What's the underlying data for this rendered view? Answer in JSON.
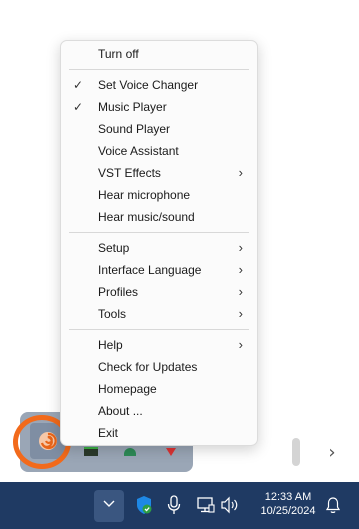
{
  "context_menu": {
    "items": [
      {
        "label": "Turn off",
        "checked": false,
        "submenu": false
      },
      {
        "label": "Set Voice Changer",
        "checked": true,
        "submenu": false
      },
      {
        "label": "Music Player",
        "checked": true,
        "submenu": false
      },
      {
        "label": "Sound Player",
        "checked": false,
        "submenu": false
      },
      {
        "label": "Voice Assistant",
        "checked": false,
        "submenu": false
      },
      {
        "label": "VST Effects",
        "checked": false,
        "submenu": true
      },
      {
        "label": "Hear microphone",
        "checked": false,
        "submenu": false
      },
      {
        "label": "Hear music/sound",
        "checked": false,
        "submenu": false
      },
      {
        "label": "Setup",
        "checked": false,
        "submenu": true
      },
      {
        "label": "Interface Language",
        "checked": false,
        "submenu": true
      },
      {
        "label": "Profiles",
        "checked": false,
        "submenu": true
      },
      {
        "label": "Tools",
        "checked": false,
        "submenu": true
      },
      {
        "label": "Help",
        "checked": false,
        "submenu": true
      },
      {
        "label": "Check for Updates",
        "checked": false,
        "submenu": false
      },
      {
        "label": "Homepage",
        "checked": false,
        "submenu": false
      },
      {
        "label": "About ...",
        "checked": false,
        "submenu": false
      },
      {
        "label": "Exit",
        "checked": false,
        "submenu": false
      }
    ],
    "check_glyph": "✓",
    "submenu_glyph": "›"
  },
  "taskbar": {
    "time": "12:33 AM",
    "date": "10/25/2024"
  },
  "colors": {
    "taskbar_bg": "#1f3a63",
    "highlight_ring": "#f26a1b",
    "tray_flyout_bg": "#9aa6b6",
    "menu_bg": "#fbfbfb"
  },
  "icons": {
    "tray_app": "voice-changer-app-icon",
    "overflow": "chevron-up-icon",
    "security": "windows-security-icon",
    "microphone": "microphone-icon",
    "network": "network-icon",
    "volume": "volume-icon",
    "notifications": "bell-icon",
    "scroll_next": "chevron-right-icon"
  }
}
